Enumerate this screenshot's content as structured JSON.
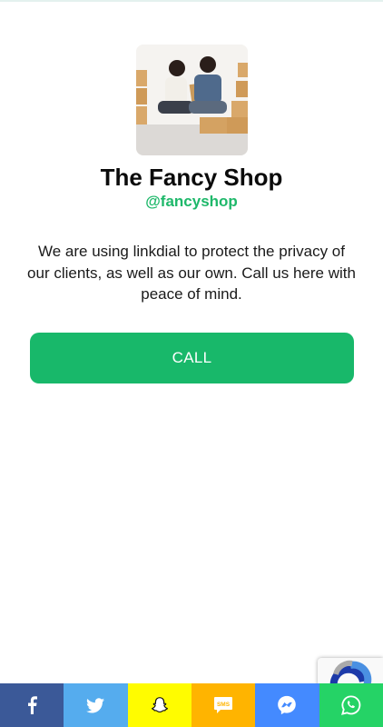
{
  "profile": {
    "name": "The Fancy Shop",
    "handle": "@fancyshop"
  },
  "description": "We are using linkdial to protect the privacy of our clients, as well as our own. Call us here with peace of mind.",
  "call_button": {
    "label": "CALL",
    "color": "#18b86a"
  },
  "share_bar": {
    "items": [
      {
        "icon": "facebook-icon",
        "color": "#3b5998"
      },
      {
        "icon": "twitter-icon",
        "color": "#55acee"
      },
      {
        "icon": "snapchat-icon",
        "color": "#fffc00"
      },
      {
        "icon": "sms-icon",
        "color": "#ffb400",
        "text": "SMS"
      },
      {
        "icon": "messenger-icon",
        "color": "#448aff"
      },
      {
        "icon": "whatsapp-icon",
        "color": "#25d366"
      }
    ]
  }
}
